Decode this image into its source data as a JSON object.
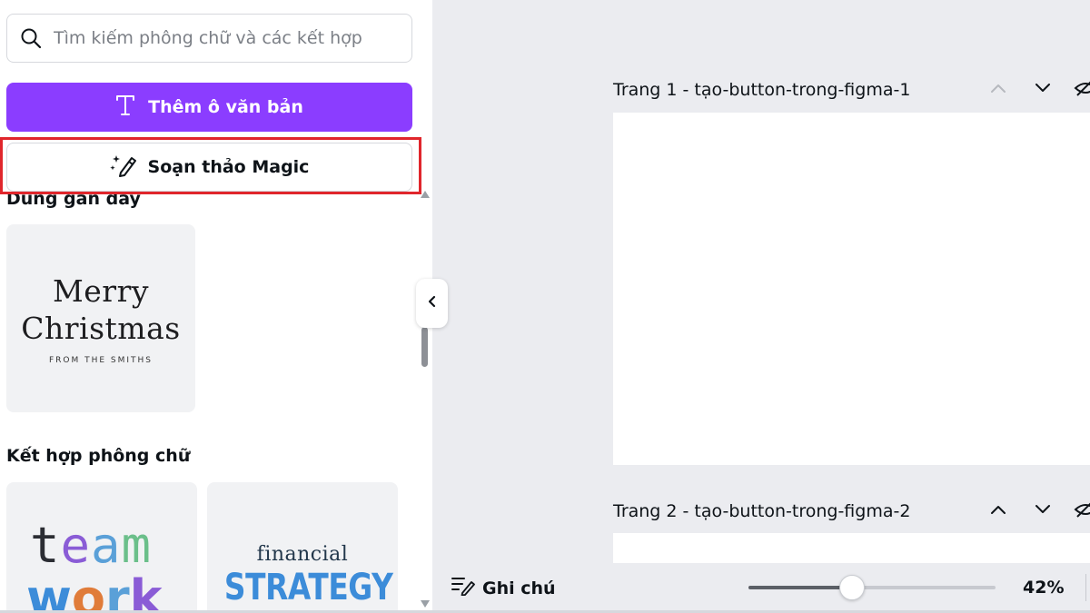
{
  "search": {
    "placeholder": "Tìm kiếm phông chữ và các kết hợp",
    "icon": "search-icon"
  },
  "buttons": {
    "add_text": {
      "label": "Thêm ô văn bản",
      "icon": "text-t-icon",
      "color": "#8b3dff"
    },
    "magic_write": {
      "label": "Soạn thảo Magic",
      "icon": "magic-pen-icon",
      "highlight_color": "#e0262c"
    }
  },
  "sections": {
    "recent": {
      "title": "Dùng gần đây"
    },
    "combos": {
      "title": "Kết hợp phông chữ"
    }
  },
  "recent_items": [
    {
      "line1": "Merry",
      "line2": "Christmas",
      "sub": "FROM THE SMITHS"
    }
  ],
  "combo_items": [
    {
      "line1": "team",
      "line2": "work"
    },
    {
      "line1": "financial",
      "line2": "STRATEGY"
    }
  ],
  "pages": [
    {
      "title": "Trang 1 - tạo-button-trong-figma-1"
    },
    {
      "title": "Trang 2 - tạo-button-trong-figma-2"
    }
  ],
  "bottombar": {
    "notes_label": "Ghi chú",
    "zoom_label": "42%",
    "zoom_level": 0.42
  }
}
